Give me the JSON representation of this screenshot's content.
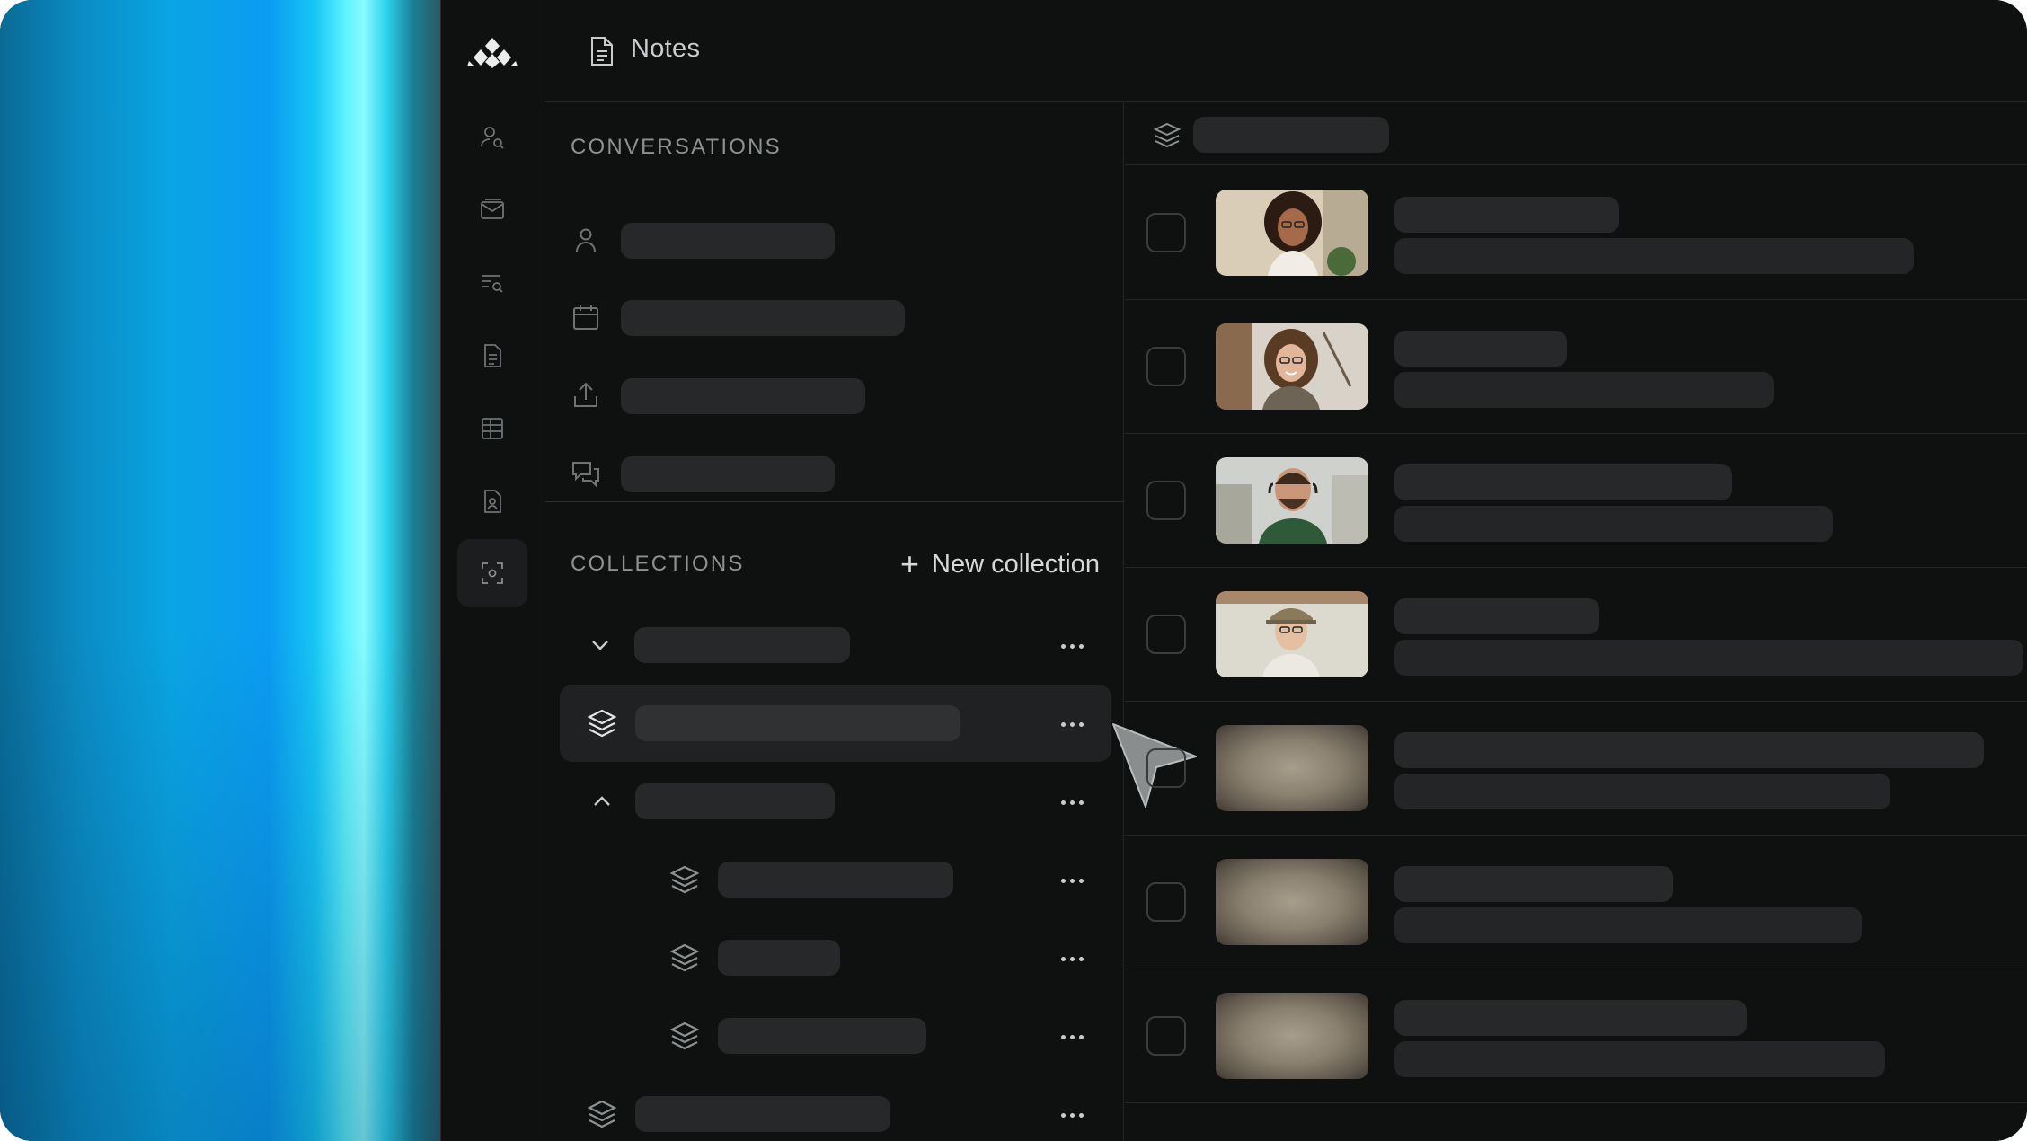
{
  "header": {
    "title": "Notes",
    "doc_icon": "document-icon"
  },
  "rail": {
    "logo": "logo-mark",
    "items": [
      {
        "icon": "user-search-icon",
        "active": false
      },
      {
        "icon": "mail-stack-icon",
        "active": false
      },
      {
        "icon": "list-search-icon",
        "active": false
      },
      {
        "icon": "document-icon",
        "active": false
      },
      {
        "icon": "table-icon",
        "active": false
      },
      {
        "icon": "file-person-icon",
        "active": false
      },
      {
        "icon": "focus-scan-icon",
        "active": true
      }
    ]
  },
  "conversations": {
    "label": "CONVERSATIONS",
    "rows": [
      {
        "icon": "person-icon"
      },
      {
        "icon": "calendar-icon"
      },
      {
        "icon": "upload-icon"
      },
      {
        "icon": "chat-bubbles-icon"
      }
    ]
  },
  "collections": {
    "label": "COLLECTIONS",
    "new_label": "New collection",
    "rows": [
      {
        "icon": "chevron-down-icon",
        "selected": false
      },
      {
        "icon": "layers-icon",
        "selected": true
      },
      {
        "icon": "chevron-up-icon",
        "selected": false
      },
      {
        "icon": "layers-icon",
        "selected": false
      },
      {
        "icon": "layers-icon",
        "selected": false
      },
      {
        "icon": "layers-icon",
        "selected": false
      },
      {
        "icon": "layers-icon",
        "selected": false
      }
    ]
  },
  "list": {
    "header_icon": "layers-icon",
    "items": [
      {
        "thumb": "person-photo"
      },
      {
        "thumb": "person-photo"
      },
      {
        "thumb": "person-photo"
      },
      {
        "thumb": "person-photo"
      },
      {
        "thumb": "blurred-photo"
      },
      {
        "thumb": "blurred-photo"
      },
      {
        "thumb": "blurred-photo"
      }
    ]
  },
  "colors": {
    "background": "#0f1010",
    "placeholder": "#262829",
    "accent_glow": "#5ff3ff"
  }
}
